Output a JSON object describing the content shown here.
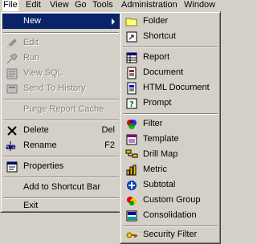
{
  "menubar": {
    "items": [
      "File",
      "Edit",
      "View",
      "Go",
      "Tools",
      "Administration",
      "Window"
    ]
  },
  "file_menu": {
    "new": "New",
    "edit": "Edit",
    "run": "Run",
    "view_sql": "View SQL",
    "send_to_history": "Send To History",
    "purge_report_cache": "Purge Report Cache",
    "delete": "Delete",
    "delete_shortcut": "Del",
    "rename": "Rename",
    "rename_shortcut": "F2",
    "properties": "Properties",
    "add_to_shortcut_bar": "Add to Shortcut Bar",
    "exit": "Exit"
  },
  "new_submenu": {
    "folder": "Folder",
    "shortcut": "Shortcut",
    "report": "Report",
    "document": "Document",
    "html_document": "HTML Document",
    "prompt": "Prompt",
    "filter": "Filter",
    "template": "Template",
    "drill_map": "Drill Map",
    "metric": "Metric",
    "subtotal": "Subtotal",
    "custom_group": "Custom Group",
    "consolidation": "Consolidation",
    "security_filter": "Security Filter"
  }
}
